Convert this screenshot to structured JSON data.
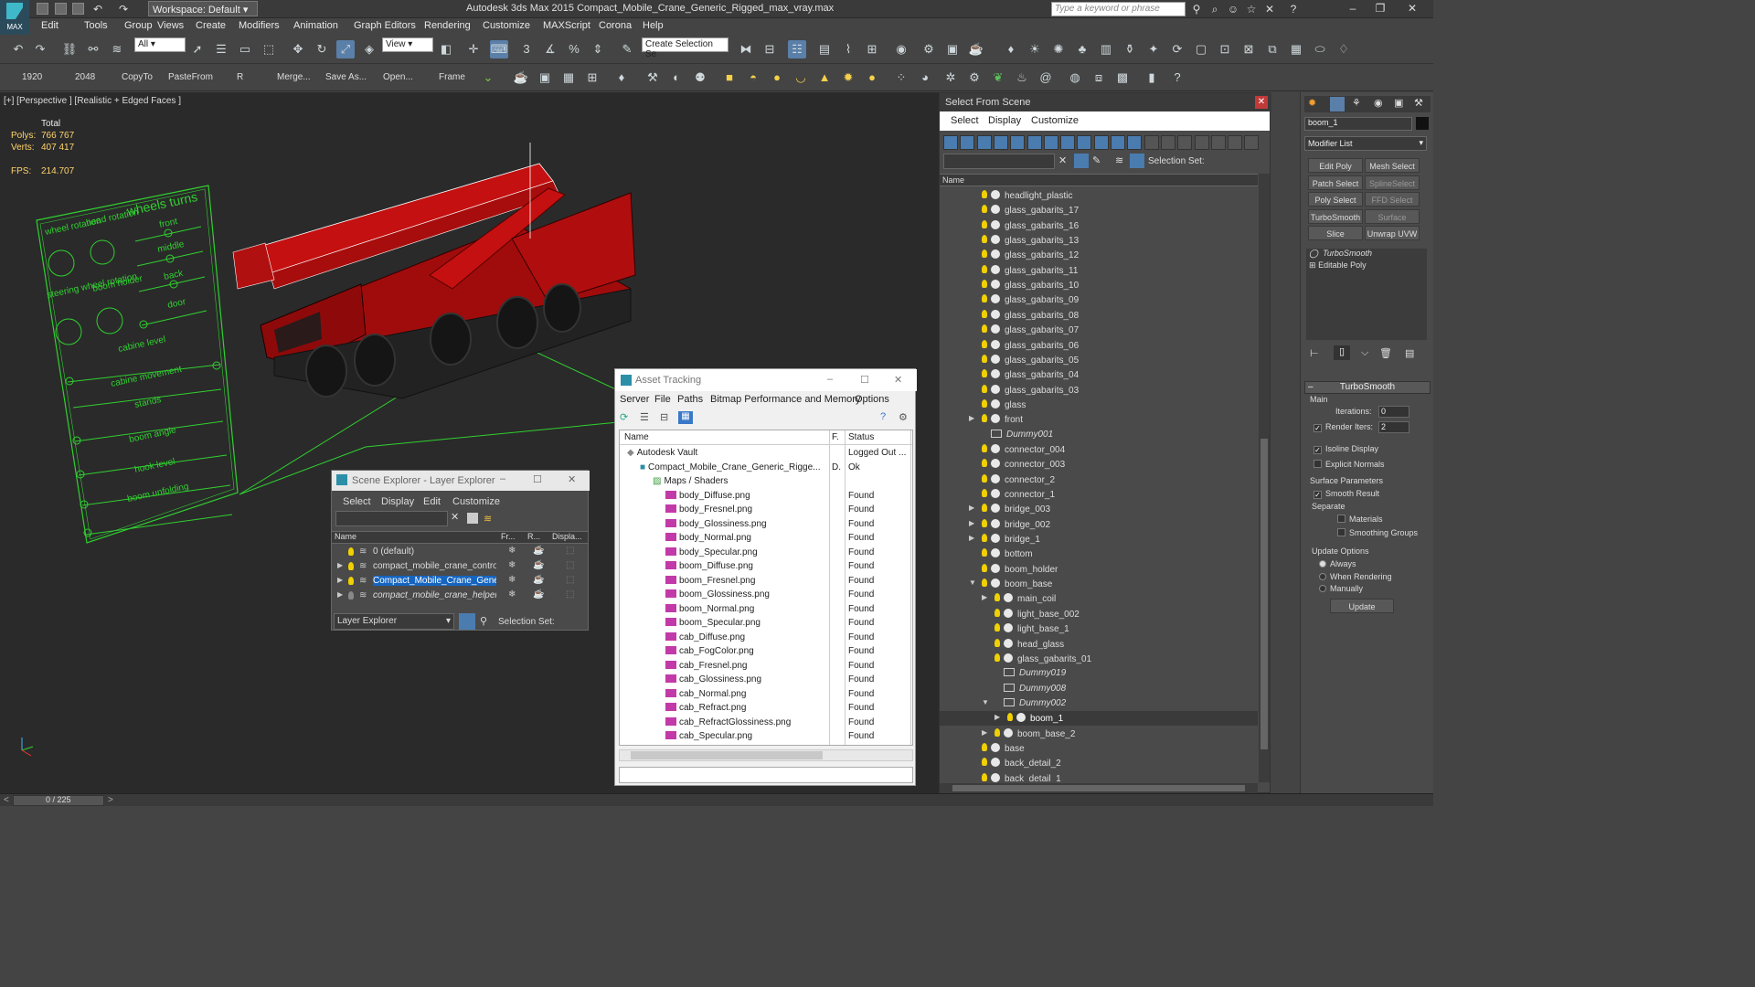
{
  "app": {
    "title": "Autodesk 3ds Max  2015     Compact_Mobile_Crane_Generic_Rigged_max_vray.max",
    "workspace": "Workspace: Default",
    "logo_text": "MAX",
    "keyword_placeholder": "Type a keyword or phrase"
  },
  "menu": [
    "Edit",
    "Tools",
    "Group",
    "Views",
    "Create",
    "Modifiers",
    "Animation",
    "Graph Editors",
    "Rendering",
    "Customize",
    "MAXScript",
    "Corona",
    "Help"
  ],
  "toolbar": {
    "selection_filter": "All",
    "ref_coord": "View",
    "named_selection": "Create Selection Se"
  },
  "toolbar2": [
    "1920",
    "2048",
    "CopyTo",
    "PasteFrom",
    "R",
    "Merge...",
    "Save As...",
    "Open...",
    "Frame"
  ],
  "viewport": {
    "label": "[+] [Perspective ] [Realistic + Edged Faces ]",
    "stats": {
      "total_label": "Total",
      "polys_label": "Polys:",
      "polys": "766 767",
      "verts_label": "Verts:",
      "verts": "407 417",
      "fps_label": "FPS:",
      "fps": "214.707"
    },
    "rig_labels": [
      "wheel rotation",
      "head rotation",
      "wheels turns",
      "front",
      "middle",
      "back",
      "door",
      "steering wheel rotation",
      "boom holder",
      "cabine level",
      "cabine movement",
      "stands",
      "boom angle",
      "hook level",
      "boom unfolding"
    ]
  },
  "select_from_scene": {
    "title": "Select From Scene",
    "menu": [
      "Select",
      "Display",
      "Customize"
    ],
    "selection_set_label": "Selection Set:",
    "column": "Name",
    "items": [
      {
        "name": "headlight_plastic",
        "type": "obj",
        "indent": 0,
        "expand": ""
      },
      {
        "name": "glass_gabarits_17",
        "type": "obj",
        "indent": 0,
        "expand": ""
      },
      {
        "name": "glass_gabarits_16",
        "type": "obj",
        "indent": 0,
        "expand": ""
      },
      {
        "name": "glass_gabarits_13",
        "type": "obj",
        "indent": 0,
        "expand": ""
      },
      {
        "name": "glass_gabarits_12",
        "type": "obj",
        "indent": 0,
        "expand": ""
      },
      {
        "name": "glass_gabarits_11",
        "type": "obj",
        "indent": 0,
        "expand": ""
      },
      {
        "name": "glass_gabarits_10",
        "type": "obj",
        "indent": 0,
        "expand": ""
      },
      {
        "name": "glass_gabarits_09",
        "type": "obj",
        "indent": 0,
        "expand": ""
      },
      {
        "name": "glass_gabarits_08",
        "type": "obj",
        "indent": 0,
        "expand": ""
      },
      {
        "name": "glass_gabarits_07",
        "type": "obj",
        "indent": 0,
        "expand": ""
      },
      {
        "name": "glass_gabarits_06",
        "type": "obj",
        "indent": 0,
        "expand": ""
      },
      {
        "name": "glass_gabarits_05",
        "type": "obj",
        "indent": 0,
        "expand": ""
      },
      {
        "name": "glass_gabarits_04",
        "type": "obj",
        "indent": 0,
        "expand": ""
      },
      {
        "name": "glass_gabarits_03",
        "type": "obj",
        "indent": 0,
        "expand": ""
      },
      {
        "name": "glass",
        "type": "obj",
        "indent": 0,
        "expand": ""
      },
      {
        "name": "front",
        "type": "obj",
        "indent": 0,
        "expand": "▶"
      },
      {
        "name": "Dummy001",
        "type": "dummy",
        "indent": 0,
        "expand": ""
      },
      {
        "name": "connector_004",
        "type": "obj",
        "indent": 0,
        "expand": ""
      },
      {
        "name": "connector_003",
        "type": "obj",
        "indent": 0,
        "expand": ""
      },
      {
        "name": "connector_2",
        "type": "obj",
        "indent": 0,
        "expand": ""
      },
      {
        "name": "connector_1",
        "type": "obj",
        "indent": 0,
        "expand": ""
      },
      {
        "name": "bridge_003",
        "type": "obj",
        "indent": 0,
        "expand": "▶"
      },
      {
        "name": "bridge_002",
        "type": "obj",
        "indent": 0,
        "expand": "▶"
      },
      {
        "name": "bridge_1",
        "type": "obj",
        "indent": 0,
        "expand": "▶"
      },
      {
        "name": "bottom",
        "type": "obj",
        "indent": 0,
        "expand": ""
      },
      {
        "name": "boom_holder",
        "type": "obj",
        "indent": 0,
        "expand": ""
      },
      {
        "name": "boom_base",
        "type": "obj",
        "indent": 0,
        "expand": "▼"
      },
      {
        "name": "main_coil",
        "type": "obj",
        "indent": 1,
        "expand": "▶"
      },
      {
        "name": "light_base_002",
        "type": "obj",
        "indent": 1,
        "expand": ""
      },
      {
        "name": "light_base_1",
        "type": "obj",
        "indent": 1,
        "expand": ""
      },
      {
        "name": "head_glass",
        "type": "obj",
        "indent": 1,
        "expand": ""
      },
      {
        "name": "glass_gabarits_01",
        "type": "obj",
        "indent": 1,
        "expand": ""
      },
      {
        "name": "Dummy019",
        "type": "dummy",
        "indent": 1,
        "expand": ""
      },
      {
        "name": "Dummy008",
        "type": "dummy",
        "indent": 1,
        "expand": ""
      },
      {
        "name": "Dummy002",
        "type": "dummy",
        "indent": 1,
        "expand": "▼"
      },
      {
        "name": "boom_1",
        "type": "obj",
        "indent": 2,
        "expand": "▶",
        "selected": true
      },
      {
        "name": "boom_base_2",
        "type": "obj",
        "indent": 1,
        "expand": "▶"
      },
      {
        "name": "base",
        "type": "obj",
        "indent": 0,
        "expand": ""
      },
      {
        "name": "back_detail_2",
        "type": "obj",
        "indent": 0,
        "expand": ""
      },
      {
        "name": "back_detail_1",
        "type": "obj",
        "indent": 0,
        "expand": ""
      }
    ]
  },
  "command_panel": {
    "object_name": "boom_1",
    "modifier_list": "Modifier List",
    "buttons": [
      "Edit Poly",
      "Mesh Select",
      "Patch Select",
      "SplineSelect",
      "Poly Select",
      "FFD Select",
      "TurboSmooth",
      "Surface Select",
      "Slice",
      "Unwrap UVW"
    ],
    "stack": [
      "TurboSmooth",
      "Editable Poly"
    ],
    "rollout_title": "TurboSmooth",
    "main_label": "Main",
    "iterations_label": "Iterations:",
    "iterations": "0",
    "render_iters_label": "Render Iters:",
    "render_iters": "2",
    "isoline": "Isoline Display",
    "explicit": "Explicit Normals",
    "surface_params": "Surface Parameters",
    "smooth_result": "Smooth Result",
    "separate": "Separate",
    "materials": "Materials",
    "smoothing_groups": "Smoothing Groups",
    "update_options": "Update Options",
    "always": "Always",
    "when_rendering": "When Rendering",
    "manually": "Manually",
    "update_btn": "Update"
  },
  "asset_tracking": {
    "title": "Asset Tracking",
    "menu": [
      "Server",
      "File",
      "Paths",
      "Bitmap Performance and Memory",
      "Options"
    ],
    "columns": [
      "Name",
      "F.",
      "Status"
    ],
    "rows": [
      {
        "name": "Autodesk Vault",
        "f": "",
        "status": "Logged Out ...",
        "indent": 0,
        "icon": "vault"
      },
      {
        "name": "Compact_Mobile_Crane_Generic_Rigge...",
        "f": "D.",
        "status": "Ok",
        "indent": 1,
        "icon": "max"
      },
      {
        "name": "Maps / Shaders",
        "f": "",
        "status": "",
        "indent": 2,
        "icon": "maps"
      },
      {
        "name": "body_Diffuse.png",
        "f": "",
        "status": "Found",
        "indent": 3,
        "icon": "png"
      },
      {
        "name": "body_Fresnel.png",
        "f": "",
        "status": "Found",
        "indent": 3,
        "icon": "png"
      },
      {
        "name": "body_Glossiness.png",
        "f": "",
        "status": "Found",
        "indent": 3,
        "icon": "png"
      },
      {
        "name": "body_Normal.png",
        "f": "",
        "status": "Found",
        "indent": 3,
        "icon": "png"
      },
      {
        "name": "body_Specular.png",
        "f": "",
        "status": "Found",
        "indent": 3,
        "icon": "png"
      },
      {
        "name": "boom_Diffuse.png",
        "f": "",
        "status": "Found",
        "indent": 3,
        "icon": "png"
      },
      {
        "name": "boom_Fresnel.png",
        "f": "",
        "status": "Found",
        "indent": 3,
        "icon": "png"
      },
      {
        "name": "boom_Glossiness.png",
        "f": "",
        "status": "Found",
        "indent": 3,
        "icon": "png"
      },
      {
        "name": "boom_Normal.png",
        "f": "",
        "status": "Found",
        "indent": 3,
        "icon": "png"
      },
      {
        "name": "boom_Specular.png",
        "f": "",
        "status": "Found",
        "indent": 3,
        "icon": "png"
      },
      {
        "name": "cab_Diffuse.png",
        "f": "",
        "status": "Found",
        "indent": 3,
        "icon": "png"
      },
      {
        "name": "cab_FogColor.png",
        "f": "",
        "status": "Found",
        "indent": 3,
        "icon": "png"
      },
      {
        "name": "cab_Fresnel.png",
        "f": "",
        "status": "Found",
        "indent": 3,
        "icon": "png"
      },
      {
        "name": "cab_Glossiness.png",
        "f": "",
        "status": "Found",
        "indent": 3,
        "icon": "png"
      },
      {
        "name": "cab_Normal.png",
        "f": "",
        "status": "Found",
        "indent": 3,
        "icon": "png"
      },
      {
        "name": "cab_Refract.png",
        "f": "",
        "status": "Found",
        "indent": 3,
        "icon": "png"
      },
      {
        "name": "cab_RefractGlossiness.png",
        "f": "",
        "status": "Found",
        "indent": 3,
        "icon": "png"
      },
      {
        "name": "cab_Specular.png",
        "f": "",
        "status": "Found",
        "indent": 3,
        "icon": "png"
      }
    ]
  },
  "layer_explorer": {
    "title": "Scene Explorer - Layer Explorer",
    "menu": [
      "Select",
      "Display",
      "Edit",
      "Customize"
    ],
    "columns": [
      "Name",
      "Fr...",
      "R...",
      "Displa..."
    ],
    "rows": [
      {
        "name": "0 (default)",
        "italic": false,
        "selected": false,
        "expand": ""
      },
      {
        "name": "compact_mobile_crane_controllers",
        "italic": false,
        "selected": false,
        "expand": "▶"
      },
      {
        "name": "Compact_Mobile_Crane_Generi...",
        "italic": false,
        "selected": true,
        "expand": "▶"
      },
      {
        "name": "compact_mobile_crane_helpers",
        "italic": true,
        "selected": false,
        "expand": "▶"
      }
    ],
    "explorer_dropdown": "Layer Explorer",
    "selection_set_label": "Selection Set:"
  },
  "status": {
    "frame": "0 / 225"
  },
  "colors": {
    "accent": "#3fb8c9",
    "rig": "#30d030",
    "crane_red": "#c41010",
    "selected_row": "#1565c0"
  }
}
